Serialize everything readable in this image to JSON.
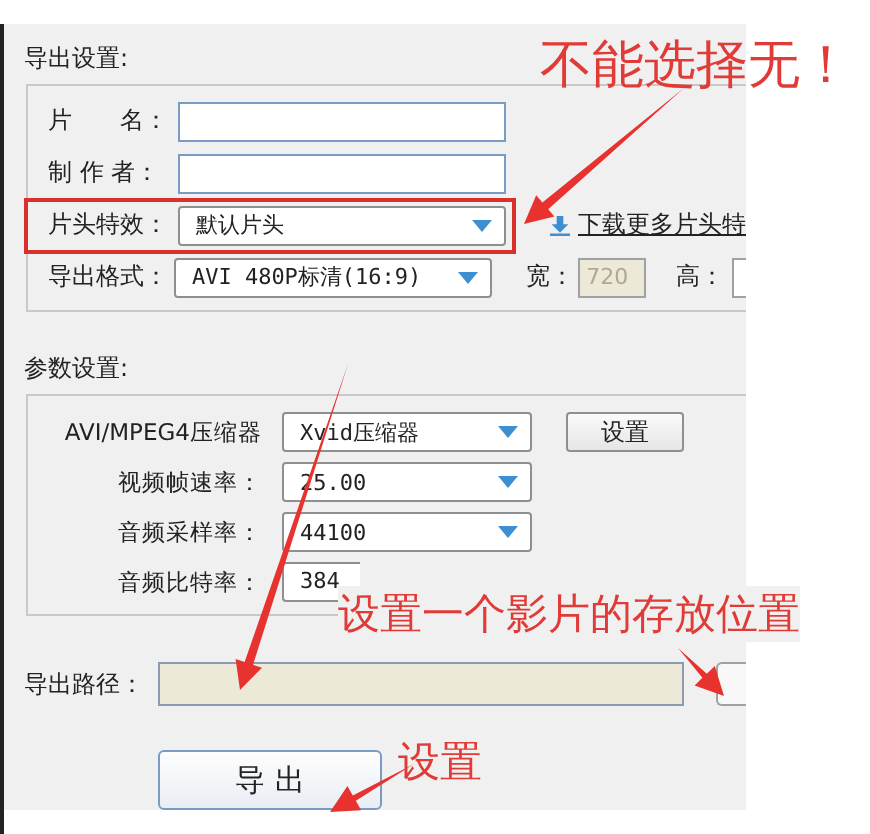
{
  "export_settings": {
    "title": "导出设置:",
    "fields": [
      {
        "kind": "text",
        "label": "片　　名："
      },
      {
        "kind": "text",
        "label": "制 作 者："
      },
      {
        "kind": "select",
        "label": "片头特效：",
        "value": "默认片头",
        "link": "下载更多片头特"
      },
      {
        "kind": "format",
        "label": "导出格式：",
        "value": "AVI 480P标清(16:9)",
        "width_label": "宽：",
        "width_value": "720",
        "width_disabled": true,
        "height_label": "高："
      }
    ]
  },
  "parameters": {
    "title": "参数设置:",
    "rows": [
      {
        "kind": "select",
        "label": "AVI/MPEG4压缩器",
        "value": "Xvid压缩器",
        "button": "设置"
      },
      {
        "kind": "select",
        "label": "视频帧速率：",
        "value": "25.00"
      },
      {
        "kind": "select",
        "label": "音频采样率：",
        "value": "44100"
      },
      {
        "kind": "covered",
        "label": "音频比特率：",
        "value": "384"
      }
    ]
  },
  "output": {
    "label": "导出路径：",
    "export_button": "导 出"
  },
  "annotations": [
    {
      "text": "不能选择无！"
    },
    {
      "text": "设置一个影片的存放位置"
    },
    {
      "text": "设置"
    }
  ]
}
